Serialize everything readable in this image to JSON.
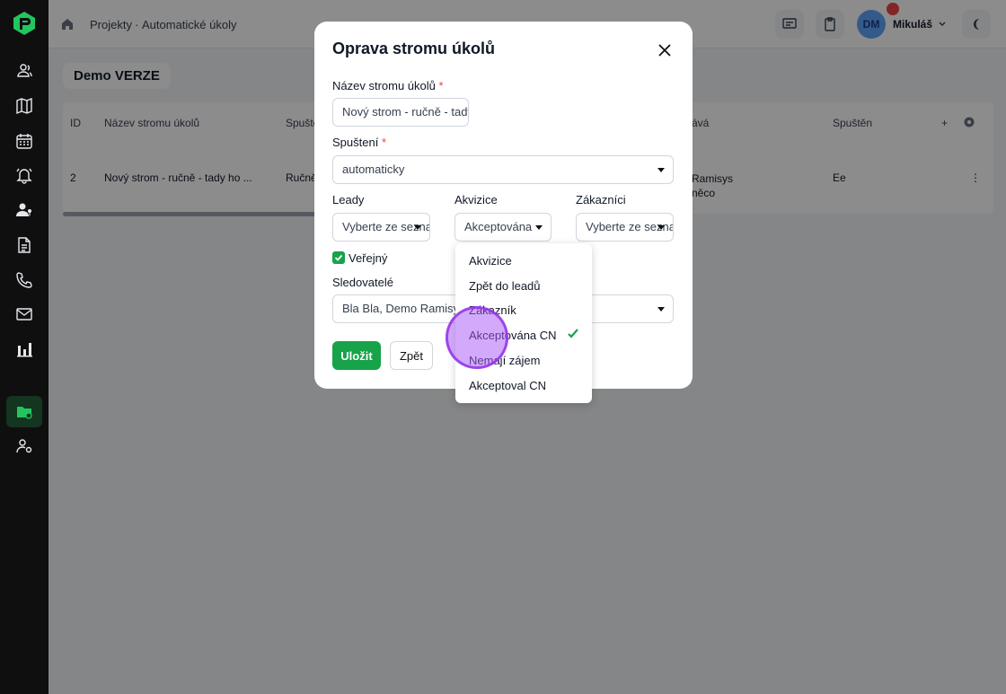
{
  "breadcrumb": {
    "projects": "Projekty",
    "separator": "·",
    "current": "Automatické úkoly"
  },
  "user": {
    "initials": "DM",
    "name": "Mikuláš"
  },
  "page": {
    "title": "Demo VERZE"
  },
  "table": {
    "headers": [
      "ID",
      "Název stromu úkolů",
      "Spuště",
      "ává",
      "Spuštěn",
      "+"
    ],
    "row": {
      "id": "2",
      "name": "Nový strom - ručně - tady ho ...",
      "trigger": "Ručně",
      "assignee": "Ramisys\nněco",
      "started": "Ee",
      "menu": "⋮"
    }
  },
  "modal": {
    "title": "Oprava stromu úkolů",
    "name_label": "Název stromu úkolů",
    "name_value": "Nový strom - ručně - tady ho",
    "trigger_label": "Spuštení",
    "trigger_value": "automaticky",
    "leads_label": "Leady",
    "leads_value": "Vyberte ze seznamu",
    "acq_label": "Akvizice",
    "acq_value": "Akceptována",
    "cust_label": "Zákazníci",
    "cust_value": "Vyberte ze seznamu",
    "public_label": "Veřejný",
    "public_checked": true,
    "followers_label": "Sledovatelé",
    "followers_value": "Bla Bla, Demo Ramisys",
    "save_label": "Uložit",
    "back_label": "Zpět",
    "required_mark": "*"
  },
  "dropdown": {
    "options": [
      "Akvizice",
      "Zpět do leadů",
      "Zákazník",
      "Akceptována CN",
      "Nemají zájem",
      "Akceptoval CN"
    ],
    "selected_index": 3
  },
  "colors": {
    "accent": "#16a34a",
    "sidebar": "#0f0f10",
    "danger": "#ef4444"
  },
  "icons": [
    "logo-icon",
    "contacts-icon",
    "map-icon",
    "calendar-icon",
    "bell-icon",
    "user-key-icon",
    "document-icon",
    "phone-icon",
    "mail-icon",
    "chart-icon",
    "folder-icon",
    "user-settings-icon"
  ]
}
